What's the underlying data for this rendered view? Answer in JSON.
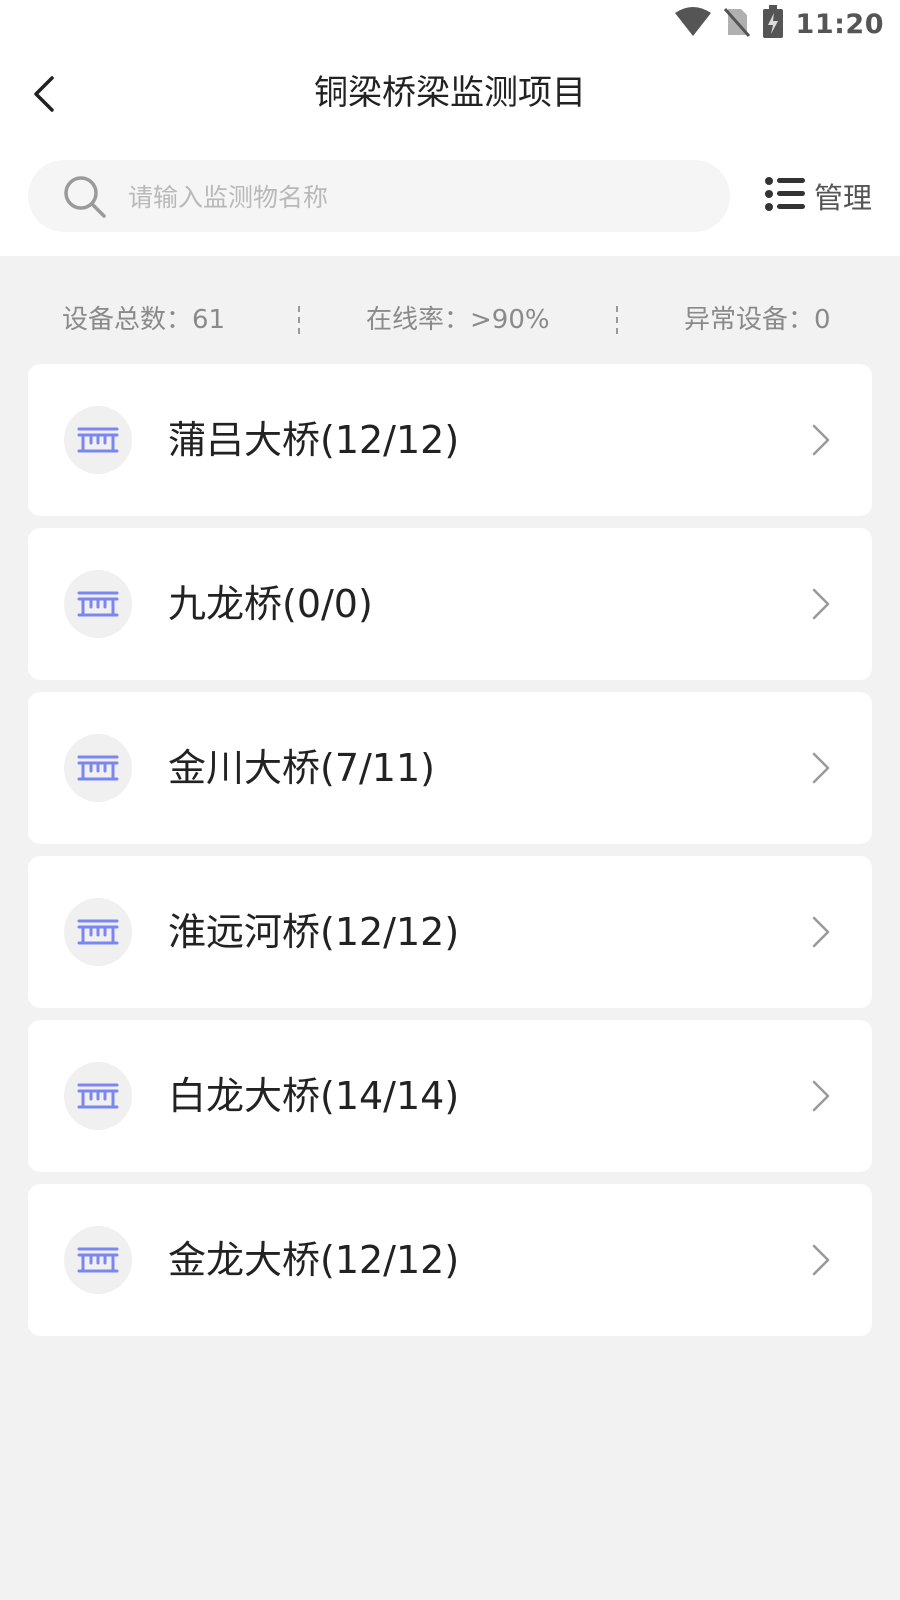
{
  "status_bar": {
    "time": "11:20",
    "icons": [
      "wifi-icon",
      "no-sim-icon",
      "battery-charging-icon"
    ]
  },
  "nav": {
    "title": "铜梁桥梁监测项目",
    "back_icon": "chevron-left-icon"
  },
  "search": {
    "placeholder": "请输入监测物名称",
    "value": "",
    "icon": "search-icon"
  },
  "manage": {
    "label": "管理",
    "icon": "list-icon"
  },
  "stats": {
    "total_label": "设备总数：61",
    "online_label": "在线率：>90%",
    "abnormal_label": "异常设备：0"
  },
  "colors": {
    "accent": "#7b86f0",
    "background": "#f2f2f2",
    "card": "#ffffff"
  },
  "bridges": [
    {
      "label": "蒲吕大桥(12/12)",
      "icon": "bridge-icon"
    },
    {
      "label": "九龙桥(0/0)",
      "icon": "bridge-icon"
    },
    {
      "label": "金川大桥(7/11)",
      "icon": "bridge-icon"
    },
    {
      "label": "淮远河桥(12/12)",
      "icon": "bridge-icon"
    },
    {
      "label": "白龙大桥(14/14)",
      "icon": "bridge-icon"
    },
    {
      "label": "金龙大桥(12/12)",
      "icon": "bridge-icon"
    }
  ]
}
